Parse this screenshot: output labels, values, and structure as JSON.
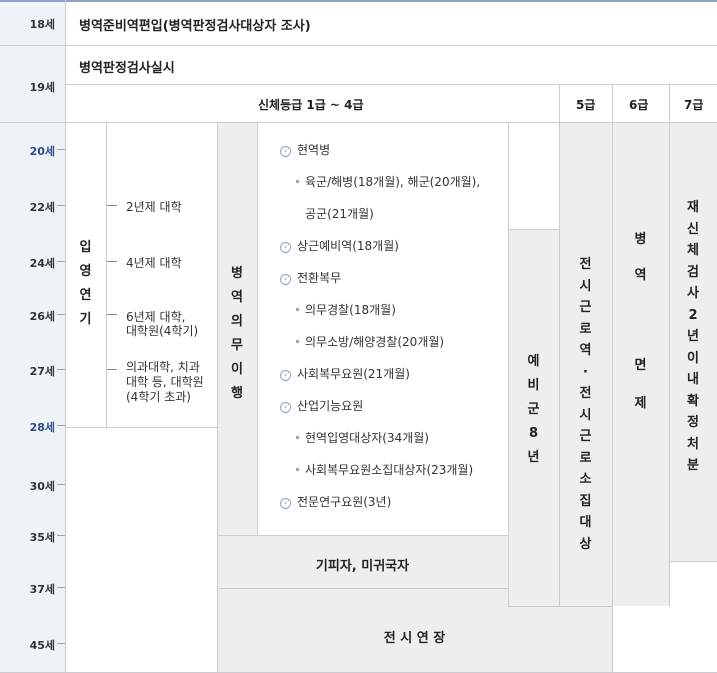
{
  "ages": [
    "18세",
    "19세",
    "20세",
    "22세",
    "24세",
    "26세",
    "27세",
    "28세",
    "30세",
    "35세",
    "37세",
    "45세"
  ],
  "row18_text": "병역준비역편입(병역판정검사대상자 조사)",
  "row19_text": "병역판정검사실시",
  "grade_headers": {
    "g1_4": "신체등급 1급 ~ 4급",
    "g5": "5급",
    "g6": "6급",
    "g7": "7급"
  },
  "postponement": {
    "label": [
      "입",
      "영",
      "연",
      "기"
    ],
    "items": [
      "2년제 대학",
      "4년제 대학",
      "6년제 대학,\n대학원(4학기)",
      "의과대학, 치과\n대학 등, 대학원\n(4학기 초과)"
    ]
  },
  "military_duty_label": [
    "병",
    "역",
    "의",
    "무",
    "이",
    "행"
  ],
  "duty_list": [
    {
      "level": 1,
      "text": "현역병"
    },
    {
      "level": 2,
      "text": "육군/해병(18개월), 해군(20개월),"
    },
    {
      "level": 3,
      "text": "공군(21개월)"
    },
    {
      "level": 1,
      "text": "상근예비역(18개월)"
    },
    {
      "level": 1,
      "text": "전환복무"
    },
    {
      "level": 2,
      "text": "의무경찰(18개월)"
    },
    {
      "level": 2,
      "text": "의무소방/해양경찰(20개월)"
    },
    {
      "level": 1,
      "text": "사회복무요원(21개월)"
    },
    {
      "level": 1,
      "text": "산업기능요원"
    },
    {
      "level": 2,
      "text": "현역입영대상자(34개월)"
    },
    {
      "level": 2,
      "text": "사회복무요원소집대상자(23개월)"
    },
    {
      "level": 1,
      "text": "전문연구요원(3년)"
    }
  ],
  "reserve_label": [
    "예",
    "비",
    "군",
    "8",
    "년"
  ],
  "grade5_label": [
    "전",
    "시",
    "근",
    "로",
    "역",
    "·",
    "전",
    "시",
    "근",
    "로",
    "소",
    "집",
    "대",
    "상"
  ],
  "grade6_label": [
    "병",
    "역",
    "면",
    "제"
  ],
  "grade7_label": [
    "재",
    "신",
    "체",
    "검",
    "사",
    "2",
    "년",
    "이",
    "내",
    "확",
    "정",
    "처",
    "분"
  ],
  "evader_text": "기피자, 미귀국자",
  "wartime_text": "전 시 연 장"
}
